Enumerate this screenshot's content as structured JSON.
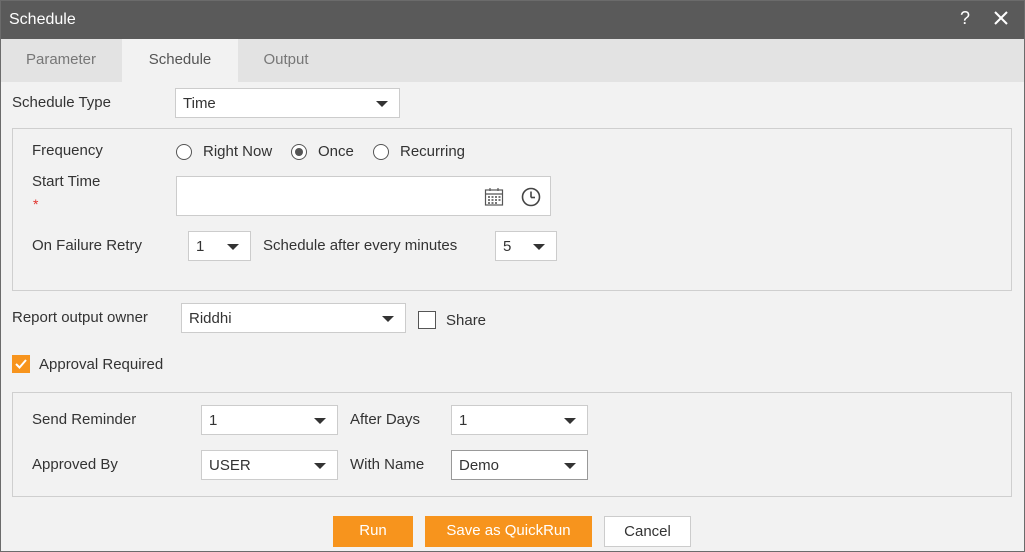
{
  "window": {
    "title": "Schedule",
    "help_label": "?"
  },
  "tabs": [
    {
      "label": "Parameter"
    },
    {
      "label": "Schedule",
      "active": true
    },
    {
      "label": "Output"
    }
  ],
  "schedule_type": {
    "label": "Schedule Type",
    "value": "Time"
  },
  "frequency": {
    "label": "Frequency",
    "options": [
      {
        "label": "Right Now",
        "selected": false
      },
      {
        "label": "Once",
        "selected": true
      },
      {
        "label": "Recurring",
        "selected": false
      }
    ]
  },
  "start_time": {
    "label": "Start Time",
    "required_mark": "*",
    "value": "",
    "icons": [
      "calendar-icon",
      "clock-icon"
    ]
  },
  "retry": {
    "label": "On Failure Retry",
    "value": "1",
    "interval_label": "Schedule after every minutes",
    "interval_value": "5"
  },
  "owner": {
    "label": "Report output owner",
    "value": "Riddhi",
    "share_label": "Share",
    "share_checked": false
  },
  "approval": {
    "label": "Approval Required",
    "checked": true,
    "send_reminder_label": "Send Reminder",
    "send_reminder_value": "1",
    "after_days_label": "After Days",
    "after_days_value": "1",
    "approved_by_label": "Approved By",
    "approved_by_value": "USER",
    "with_name_label": "With Name",
    "with_name_value": "Demo"
  },
  "buttons": {
    "run": "Run",
    "save_quickrun": "Save as QuickRun",
    "cancel": "Cancel"
  },
  "colors": {
    "accent": "#f7941d",
    "titlebar": "#5a5a5a",
    "required": "#e0312c"
  }
}
